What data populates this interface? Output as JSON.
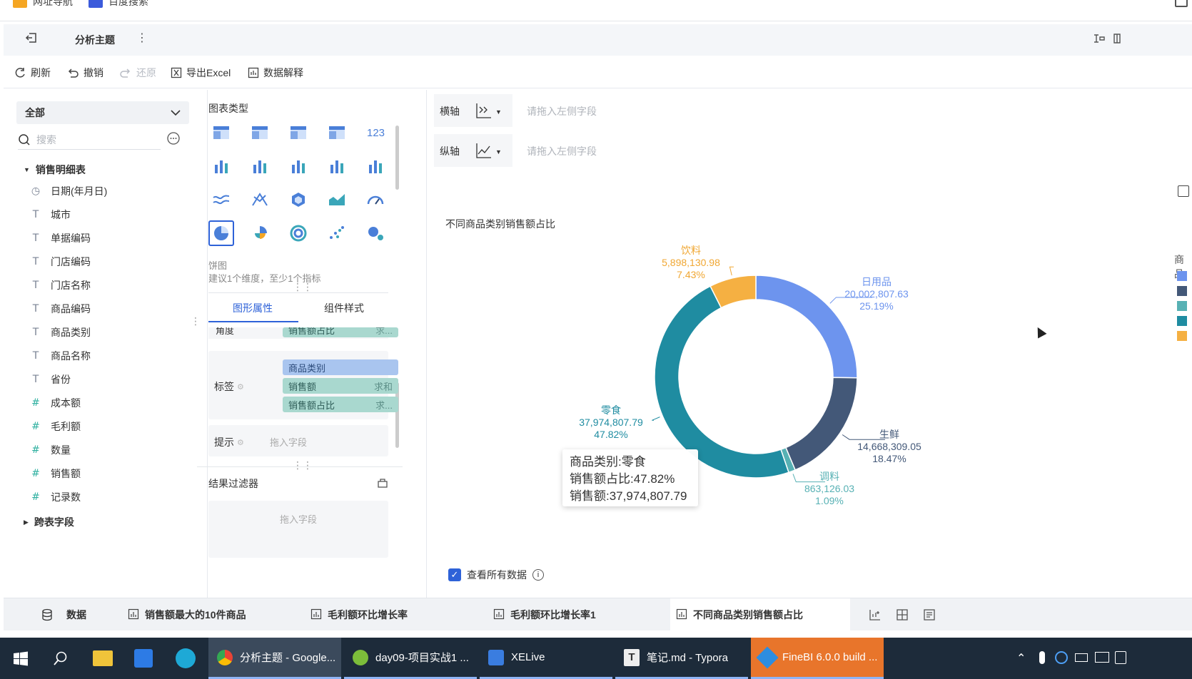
{
  "bookmarks": [
    {
      "label": "网址导航",
      "icon": "nav-icon"
    },
    {
      "label": "百度搜索",
      "icon": "baidu-icon"
    }
  ],
  "header": {
    "title": "分析主题"
  },
  "toolbar": {
    "refresh": "刷新",
    "undo": "撤销",
    "redo": "还原",
    "export": "导出Excel",
    "explain": "数据解释"
  },
  "fields": {
    "scope": "全部",
    "search_placeholder": "搜索",
    "table": "销售明细表",
    "items": [
      {
        "type": "date",
        "label": "日期(年月日)"
      },
      {
        "type": "text",
        "label": "城市"
      },
      {
        "type": "text",
        "label": "单据编码"
      },
      {
        "type": "text",
        "label": "门店编码"
      },
      {
        "type": "text",
        "label": "门店名称"
      },
      {
        "type": "text",
        "label": "商品编码"
      },
      {
        "type": "text",
        "label": "商品类别"
      },
      {
        "type": "text",
        "label": "商品名称"
      },
      {
        "type": "text",
        "label": "省份"
      },
      {
        "type": "num",
        "label": "成本额"
      },
      {
        "type": "num",
        "label": "毛利额"
      },
      {
        "type": "num",
        "label": "数量"
      },
      {
        "type": "num",
        "label": "销售额"
      },
      {
        "type": "num",
        "label": "记录数"
      }
    ],
    "cross": "跨表字段"
  },
  "config": {
    "chart_type_title": "图表类型",
    "selected_name": "饼图",
    "hint": "建议1个维度，至少1个指标",
    "tab_props": "图形属性",
    "tab_style": "组件样式",
    "angle_label": "角度",
    "angle_pill": "销售额占比",
    "angle_agg": "求...",
    "label_label": "标签",
    "label_pills": [
      {
        "name": "商品类别",
        "agg": ""
      },
      {
        "name": "销售额",
        "agg": "求和"
      },
      {
        "name": "销售额占比",
        "agg": "求..."
      }
    ],
    "tip_label": "提示",
    "drop_field": "拖入字段",
    "filter_title": "结果过滤器",
    "filter_drop": "拖入字段"
  },
  "axes": {
    "x_label": "横轴",
    "y_label": "纵轴",
    "placeholder": "请拖入左侧字段"
  },
  "chart_data": {
    "type": "pie",
    "title": "不同商品类别销售额占比",
    "legend_title": "商品",
    "slices": [
      {
        "name": "日用品",
        "value_label": "20,002,807.63",
        "pct_label": "25.19%",
        "pct": 25.19,
        "color": "#6d94ee"
      },
      {
        "name": "生鲜",
        "value_label": "14,668,309.05",
        "pct_label": "18.47%",
        "pct": 18.47,
        "color": "#435878"
      },
      {
        "name": "调料",
        "value_label": "863,126.03",
        "pct_label": "1.09%",
        "pct": 1.09,
        "color": "#57b1b4"
      },
      {
        "name": "零食",
        "value_label": "37,974,807.79",
        "pct_label": "47.82%",
        "pct": 47.82,
        "color": "#1f8ca1"
      },
      {
        "name": "饮料",
        "value_label": "5,898,130.98",
        "pct_label": "7.43%",
        "pct": 7.43,
        "color": "#f5b042"
      }
    ]
  },
  "tooltip": {
    "line1": "商品类别:零食",
    "line2": "销售额占比:47.82%",
    "line3": "销售额:37,974,807.79"
  },
  "view_all": "查看所有数据",
  "tabs": [
    {
      "label": "数据"
    },
    {
      "label": "销售额最大的10件商品"
    },
    {
      "label": "毛利额环比增长率"
    },
    {
      "label": "毛利额环比增长率1"
    },
    {
      "label": "不同商品类别销售额占比"
    }
  ],
  "taskbar": [
    {
      "label": "分析主题 - Google..."
    },
    {
      "label": "day09-项目实战1 ..."
    },
    {
      "label": "XELive"
    },
    {
      "label": "笔记.md - Typora"
    },
    {
      "label": "FineBI 6.0.0 build ..."
    }
  ]
}
